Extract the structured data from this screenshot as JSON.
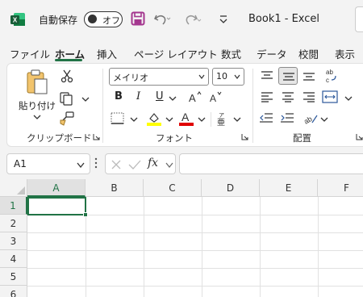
{
  "titlebar": {
    "autosave_label": "自動保存",
    "autosave_state": "オフ",
    "doc_title": "Book1  -  Excel"
  },
  "tabs": [
    "ファイル",
    "ホーム",
    "挿入",
    "ページ レイアウト",
    "数式",
    "データ",
    "校閲",
    "表示"
  ],
  "active_tab": "ホーム",
  "ribbon": {
    "clipboard": {
      "paste_label": "貼り付け",
      "group_label": "クリップボード"
    },
    "font": {
      "font_name": "メイリオ",
      "font_size": "10",
      "bold": "B",
      "italic": "I",
      "underline": "U",
      "group_label": "フォント"
    },
    "alignment": {
      "group_label": "配置"
    }
  },
  "formula_bar": {
    "name_box": "A1",
    "fx": "fx"
  },
  "grid": {
    "columns": [
      "A",
      "B",
      "C",
      "D",
      "E",
      "F"
    ],
    "rows": [
      "1",
      "2",
      "3",
      "4",
      "5",
      "6"
    ],
    "active_cell": "A1"
  },
  "colors": {
    "accent": "#217346",
    "highlight": "#ffff00",
    "font_color": "#e00000",
    "save_purple": "#a4378f"
  }
}
